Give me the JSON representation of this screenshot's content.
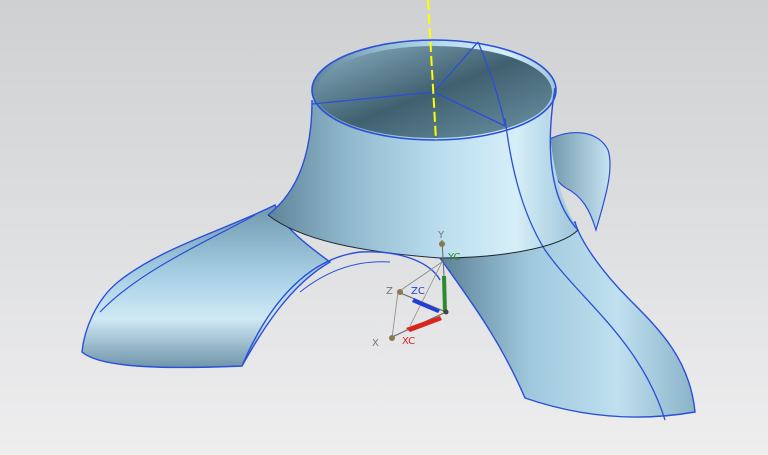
{
  "viewport": {
    "background_top": "#cfd0d2",
    "background_bottom": "#eeeeef"
  },
  "model": {
    "surface_color": "#8fbbd6",
    "highlight_color": "#d8eef8",
    "shadow_color": "#4a6a7c",
    "edge_color": "#2a4fd8",
    "seam_color": "#1f2a33"
  },
  "axis": {
    "line_color": "#ffff00",
    "line_style": "dashed"
  },
  "triad": {
    "zc_label": "ZC",
    "xc_label": "XC",
    "yc_label": "YC",
    "x_label": "X",
    "y_label": "Y",
    "z_label": "Z",
    "xc_color": "#d8261e",
    "yc_color": "#2e8a2e",
    "zc_color": "#1f3fd6"
  }
}
